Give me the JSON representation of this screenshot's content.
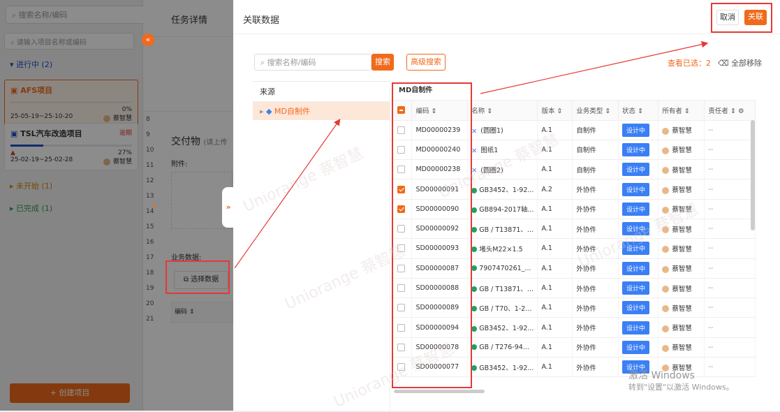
{
  "sidebar": {
    "search_placeholder": "搜索名称/编码",
    "project_search_placeholder": "请输入项目名称或编码",
    "groups": {
      "in_progress": "进行中 (2)",
      "not_started": "未开始 (1)",
      "done": "已完成 (1)"
    },
    "projects": [
      {
        "name": "AFS项目",
        "progress": "0%",
        "dates": "25-05-19~25-10-20",
        "owner": "蔡智慧",
        "status": ""
      },
      {
        "name": "TSL汽车改造项目",
        "progress": "27%",
        "dates": "25-02-19~25-02-28",
        "owner": "蔡智慧",
        "status": "逾期"
      }
    ],
    "create_label": "+ 创建项目"
  },
  "middle": {
    "title": "任务详情",
    "deliverables": "交付物",
    "deliverables_hint": "(请上传",
    "attachment": "附件:",
    "business_data": "业务数据:",
    "select_data": "选择数据",
    "col_code": "编码",
    "row_numbers": [
      "8",
      "9",
      "10",
      "11",
      "12",
      "13",
      "14",
      "15",
      "16",
      "17",
      "18",
      "19",
      "20",
      "21"
    ]
  },
  "modal": {
    "title": "关联数据",
    "cancel": "取消",
    "link": "关联",
    "search_placeholder": "搜索名称/编码",
    "search_button": "搜索",
    "advanced_search": "高级搜索",
    "selected_label": "查看已选：",
    "selected_count": "2",
    "remove_all": "全部移除",
    "source_header": "来源",
    "source_item": "MD自制件",
    "table_title": "MD自制件",
    "columns": [
      "编码",
      "名称",
      "版本",
      "业务类型",
      "状态",
      "所有者",
      "责任者"
    ],
    "rows": [
      {
        "checked": false,
        "code": "MD00000239",
        "name": "(圆圈1)",
        "ver": "A.1",
        "type": "自制件",
        "icon": "blue",
        "status": "设计中",
        "owner": "蔡智慧",
        "resp": "--"
      },
      {
        "checked": false,
        "code": "MD00000240",
        "name": "图纸1",
        "ver": "A.1",
        "type": "自制件",
        "icon": "blue",
        "status": "设计中",
        "owner": "蔡智慧",
        "resp": "--"
      },
      {
        "checked": false,
        "code": "MD00000238",
        "name": "(圆圈2)",
        "ver": "A.1",
        "type": "自制件",
        "icon": "blue",
        "status": "设计中",
        "owner": "蔡智慧",
        "resp": "--"
      },
      {
        "checked": true,
        "code": "SD00000091",
        "name": "GB3452、1-92...",
        "ver": "A.2",
        "type": "外协件",
        "icon": "green",
        "status": "设计中",
        "owner": "蔡智慧",
        "resp": "--"
      },
      {
        "checked": true,
        "code": "SD00000090",
        "name": "GB894-2017轴...",
        "ver": "A.1",
        "type": "外协件",
        "icon": "green",
        "status": "设计中",
        "owner": "蔡智慧",
        "resp": "--"
      },
      {
        "checked": false,
        "code": "SD00000092",
        "name": "GB / T13871、...",
        "ver": "A.1",
        "type": "外协件",
        "icon": "green",
        "status": "设计中",
        "owner": "蔡智慧",
        "resp": "--"
      },
      {
        "checked": false,
        "code": "SD00000093",
        "name": "堵头M22×1.5",
        "ver": "A.1",
        "type": "外协件",
        "icon": "green",
        "status": "设计中",
        "owner": "蔡智慧",
        "resp": "--"
      },
      {
        "checked": false,
        "code": "SD00000087",
        "name": "7907470261_...",
        "ver": "A.1",
        "type": "外协件",
        "icon": "green",
        "status": "设计中",
        "owner": "蔡智慧",
        "resp": "--"
      },
      {
        "checked": false,
        "code": "SD00000088",
        "name": "GB / T13871、...",
        "ver": "A.1",
        "type": "外协件",
        "icon": "green",
        "status": "设计中",
        "owner": "蔡智慧",
        "resp": "--"
      },
      {
        "checked": false,
        "code": "SD00000089",
        "name": "GB / T70、1-2...",
        "ver": "A.1",
        "type": "外协件",
        "icon": "green",
        "status": "设计中",
        "owner": "蔡智慧",
        "resp": "--"
      },
      {
        "checked": false,
        "code": "SD00000094",
        "name": "GB3452、1-92...",
        "ver": "A.1",
        "type": "外协件",
        "icon": "green",
        "status": "设计中",
        "owner": "蔡智慧",
        "resp": "--"
      },
      {
        "checked": false,
        "code": "SD00000078",
        "name": "GB / T276-94...",
        "ver": "A.1",
        "type": "外协件",
        "icon": "green",
        "status": "设计中",
        "owner": "蔡智慧",
        "resp": "--"
      },
      {
        "checked": false,
        "code": "SD00000077",
        "name": "GB3452、1-92...",
        "ver": "A.1",
        "type": "外协件",
        "icon": "green",
        "status": "设计中",
        "owner": "蔡智慧",
        "resp": "--"
      }
    ]
  },
  "watermark": "Uniorange 蔡智慧",
  "windows_watermark": {
    "line1": "激活 Windows",
    "line2": "转到\"设置\"以激活 Windows。"
  },
  "colors": {
    "accent": "#f06a1b",
    "status_blue": "#3b7ff5",
    "highlight_red": "#e53935"
  }
}
